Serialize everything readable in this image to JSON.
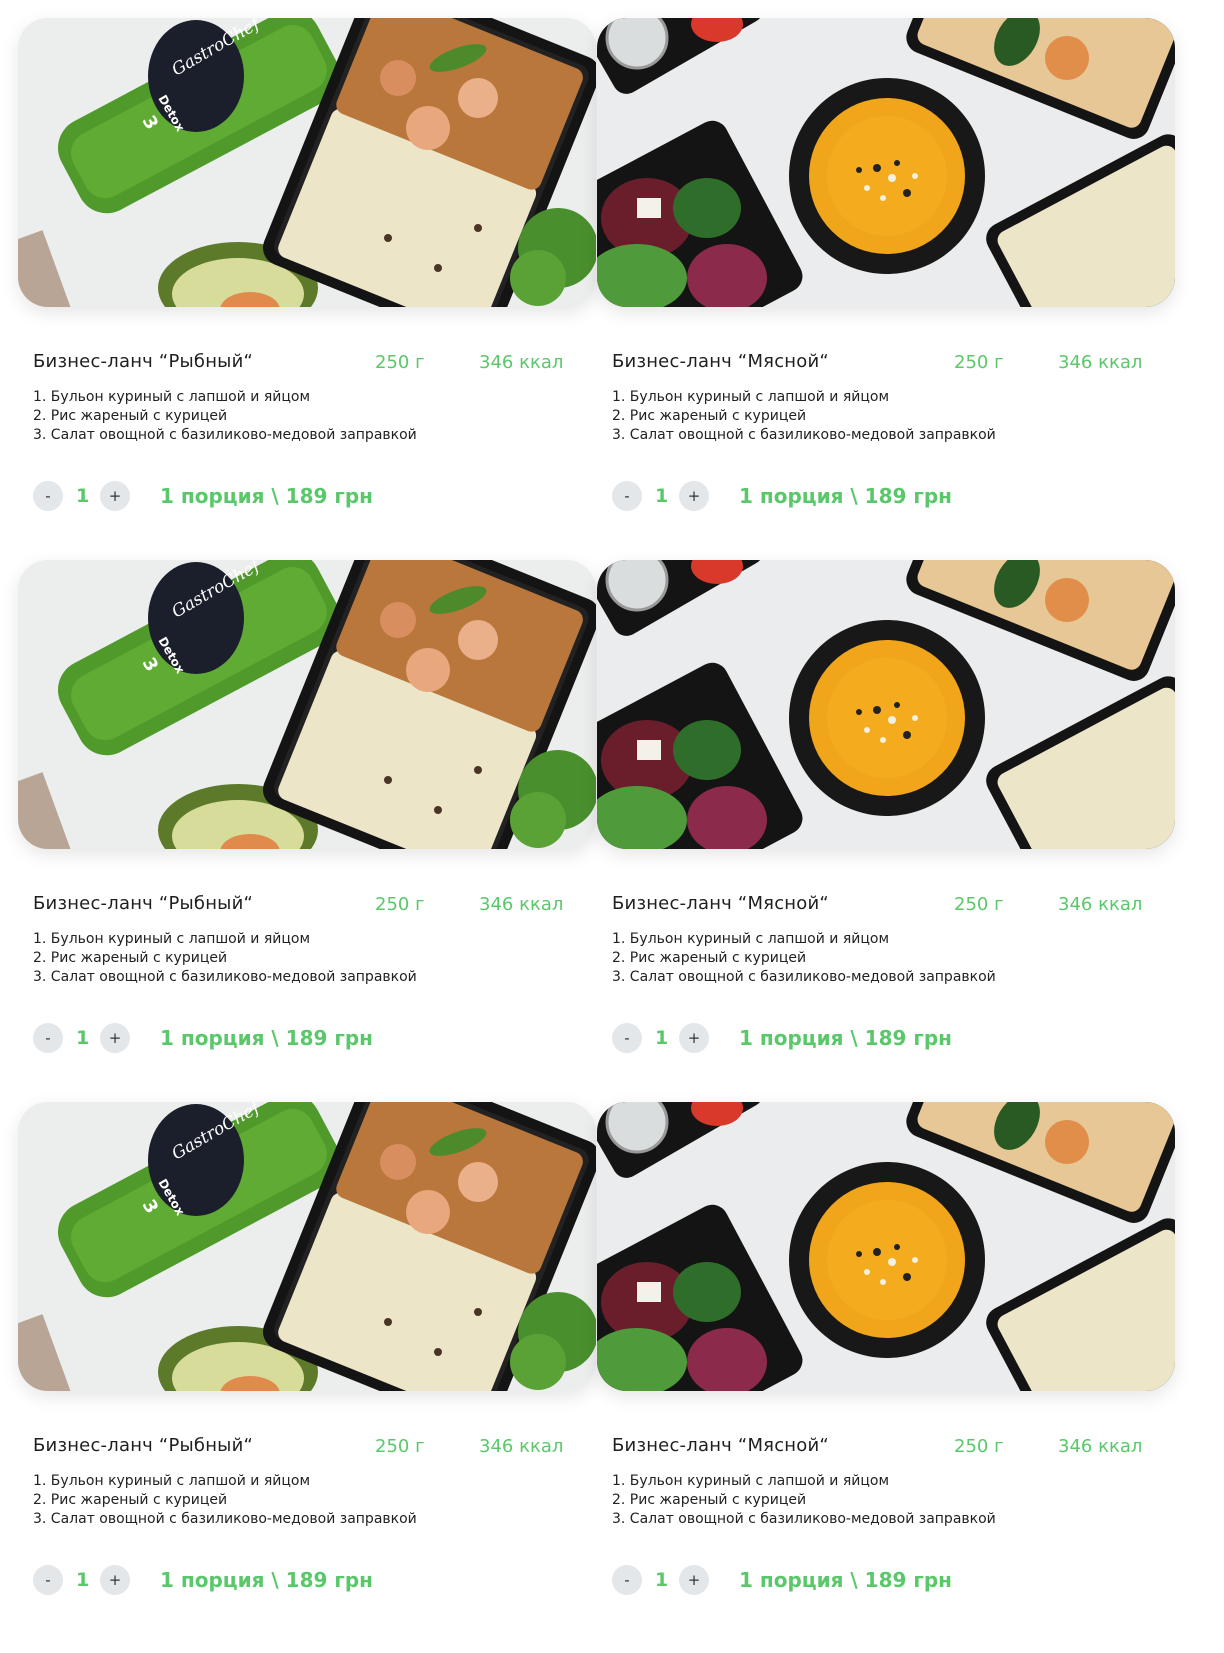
{
  "colors": {
    "accent": "#5ac86a",
    "button_bg": "#e3e7ea",
    "text": "#222222"
  },
  "cards": [
    {
      "title": "Бизнес-ланч “Рыбный“",
      "weight": "250 г",
      "kcal": "346 ккал",
      "items": [
        "1. Бульон куриный с лапшой и яйцом",
        "2. Рис жареный с курицей",
        "3. Салат овощной с базиликово-медовой заправкой"
      ],
      "qty": "1",
      "minus": "-",
      "plus": "+",
      "price": "1 порция \\ 189 грн",
      "photo": "rice-chicken-detox-bottle"
    },
    {
      "title": "Бизнес-ланч “Мясной“",
      "weight": "250 г",
      "kcal": "346 ккал",
      "items": [
        "1. Бульон куриный с лапшой и яйцом",
        "2. Рис жареный с курицей",
        "3. Салат овощной с базиликово-медовой заправкой"
      ],
      "qty": "1",
      "minus": "-",
      "plus": "+",
      "price": "1 порция \\ 189 грн",
      "photo": "pumpkin-soup-salad"
    },
    {
      "title": "Бизнес-ланч “Рыбный“",
      "weight": "250 г",
      "kcal": "346 ккал",
      "items": [
        "1. Бульон куриный с лапшой и яйцом",
        "2. Рис жареный с курицей",
        "3. Салат овощной с базиликово-медовой заправкой"
      ],
      "qty": "1",
      "minus": "-",
      "plus": "+",
      "price": "1 порция \\ 189 грн",
      "photo": "rice-chicken-detox-bottle"
    },
    {
      "title": "Бизнес-ланч “Мясной“",
      "weight": "250 г",
      "kcal": "346 ккал",
      "items": [
        "1. Бульон куриный с лапшой и яйцом",
        "2. Рис жареный с курицей",
        "3. Салат овощной с базиликово-медовой заправкой"
      ],
      "qty": "1",
      "minus": "-",
      "plus": "+",
      "price": "1 порция \\ 189 грн",
      "photo": "pumpkin-soup-salad"
    },
    {
      "title": "Бизнес-ланч “Рыбный“",
      "weight": "250 г",
      "kcal": "346 ккал",
      "items": [
        "1. Бульон куриный с лапшой и яйцом",
        "2. Рис жареный с курицей",
        "3. Салат овощной с базиликово-медовой заправкой"
      ],
      "qty": "1",
      "minus": "-",
      "plus": "+",
      "price": "1 порция \\ 189 грн",
      "photo": "rice-chicken-detox-bottle"
    },
    {
      "title": "Бизнес-ланч “Мясной“",
      "weight": "250 г",
      "kcal": "346 ккал",
      "items": [
        "1. Бульон куриный с лапшой и яйцом",
        "2. Рис жареный с курицей",
        "3. Салат овощной с базиликово-медовой заправкой"
      ],
      "qty": "1",
      "minus": "-",
      "plus": "+",
      "price": "1 порция \\ 189 грн",
      "photo": "pumpkin-soup-salad"
    }
  ],
  "bottle_label": {
    "brand": "GastroChef",
    "line": "Detox",
    "number": "3"
  }
}
